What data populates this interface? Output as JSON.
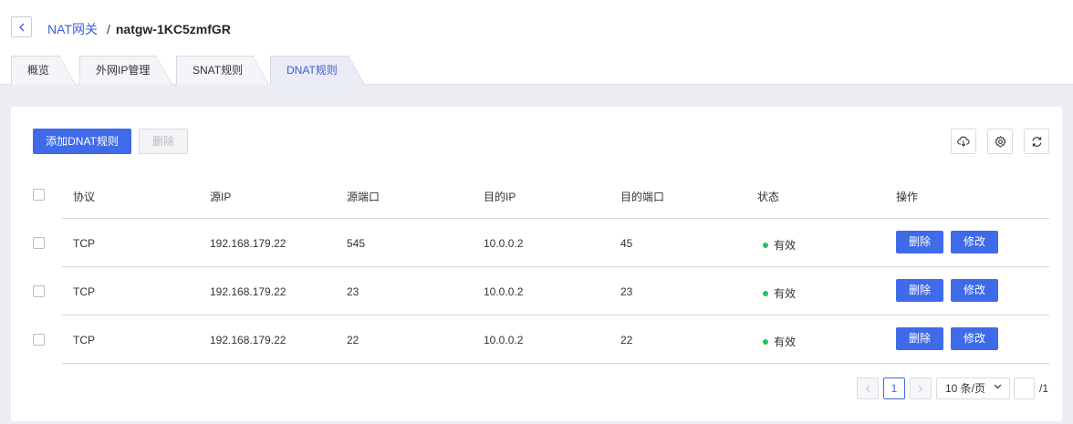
{
  "breadcrumb": {
    "parent": "NAT网关",
    "separator": "/",
    "current": "natgw-1KC5zmfGR"
  },
  "tabs": [
    {
      "label": "概览",
      "active": false
    },
    {
      "label": "外网IP管理",
      "active": false
    },
    {
      "label": "SNAT规则",
      "active": false
    },
    {
      "label": "DNAT规则",
      "active": true
    }
  ],
  "toolbar": {
    "add_label": "添加DNAT规则",
    "delete_label": "删除"
  },
  "toolbar_icons": [
    "cloud-download-icon",
    "gear-icon",
    "refresh-icon"
  ],
  "table": {
    "headers": [
      "协议",
      "源IP",
      "源端口",
      "目的IP",
      "目的端口",
      "状态",
      "操作"
    ],
    "rows": [
      {
        "protocol": "TCP",
        "src_ip": "192.168.179.22",
        "src_port": "545",
        "dst_ip": "10.0.0.2",
        "dst_port": "45",
        "status": "有效",
        "delete": "删除",
        "edit": "修改"
      },
      {
        "protocol": "TCP",
        "src_ip": "192.168.179.22",
        "src_port": "23",
        "dst_ip": "10.0.0.2",
        "dst_port": "23",
        "status": "有效",
        "delete": "删除",
        "edit": "修改"
      },
      {
        "protocol": "TCP",
        "src_ip": "192.168.179.22",
        "src_port": "22",
        "dst_ip": "10.0.0.2",
        "dst_port": "22",
        "status": "有效",
        "delete": "删除",
        "edit": "修改"
      }
    ]
  },
  "pagination": {
    "current_page": "1",
    "page_size": "10 条/页",
    "total_pages": "/1"
  },
  "colors": {
    "primary": "#3f6ae8",
    "status_ok": "#22c35f",
    "link": "#3d5fd8"
  }
}
